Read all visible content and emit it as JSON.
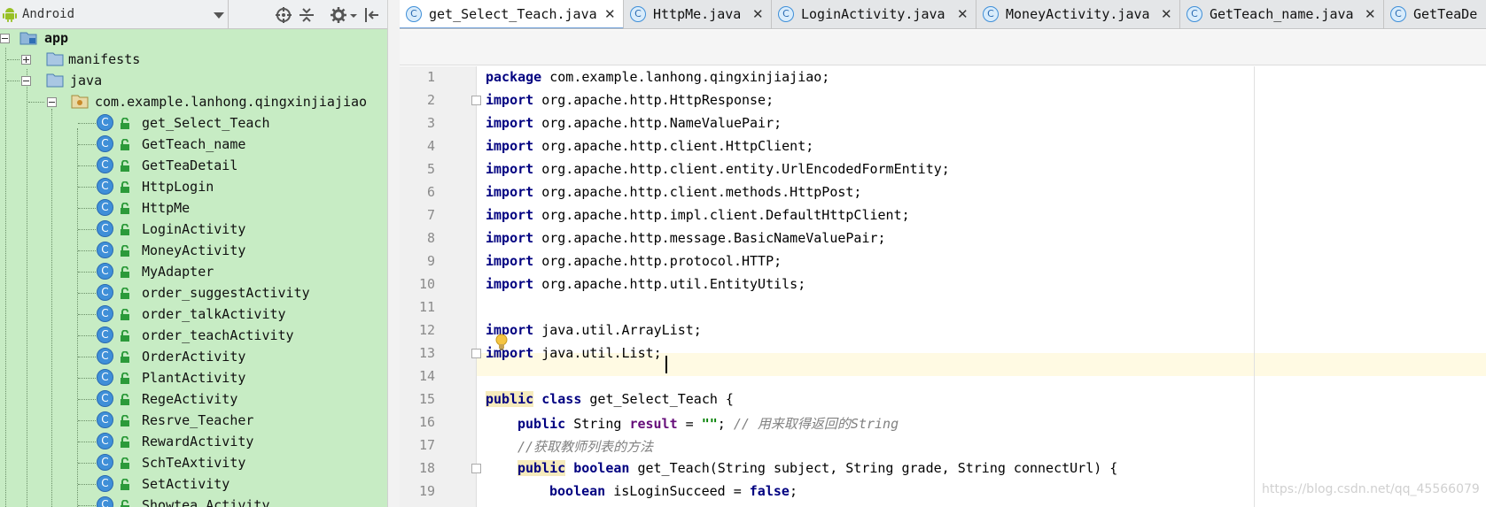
{
  "project_panel": {
    "view_mode": "Android",
    "tree": {
      "root": "app",
      "manifests": "manifests",
      "java": "java",
      "package": "com.example.lanhong.qingxinjiajiao",
      "classes": [
        "get_Select_Teach",
        "GetTeach_name",
        "GetTeaDetail",
        "HttpLogin",
        "HttpMe",
        "LoginActivity",
        "MoneyActivity",
        "MyAdapter",
        "order_suggestActivity",
        "order_talkActivity",
        "order_teachActivity",
        "OrderActivity",
        "PlantActivity",
        "RegeActivity",
        "Resrve_Teacher",
        "RewardActivity",
        "SchTeAxtivity",
        "SetActivity",
        "Showtea Activity"
      ]
    },
    "icons": [
      "android-icon",
      "target-icon",
      "collapse-all-icon",
      "gear-icon",
      "hide-panel-icon"
    ]
  },
  "tabs": [
    {
      "label": "get_Select_Teach.java",
      "active": true
    },
    {
      "label": "HttpMe.java",
      "active": false
    },
    {
      "label": "LoginActivity.java",
      "active": false
    },
    {
      "label": "MoneyActivity.java",
      "active": false
    },
    {
      "label": "GetTeach_name.java",
      "active": false
    },
    {
      "label": "GetTeaDe",
      "active": false
    }
  ],
  "editor": {
    "line_numbers": [
      "1",
      "2",
      "3",
      "4",
      "5",
      "6",
      "7",
      "8",
      "9",
      "10",
      "11",
      "12",
      "13",
      "14",
      "15",
      "16",
      "17",
      "18",
      "19"
    ],
    "caret_line": 13,
    "lines": {
      "l1_kw": "package",
      "l1_rest": " com.example.lanhong.qingxinjiajiao;",
      "l2_kw": "import",
      "l2_rest": " org.apache.http.HttpResponse;",
      "l3_kw": "import",
      "l3_rest": " org.apache.http.NameValuePair;",
      "l4_kw": "import",
      "l4_rest": " org.apache.http.client.HttpClient;",
      "l5_kw": "import",
      "l5_rest": " org.apache.http.client.entity.UrlEncodedFormEntity;",
      "l6_kw": "import",
      "l6_rest": " org.apache.http.client.methods.HttpPost;",
      "l7_kw": "import",
      "l7_rest": " org.apache.http.impl.client.DefaultHttpClient;",
      "l8_kw": "import",
      "l8_rest": " org.apache.http.message.BasicNameValuePair;",
      "l9_kw": "import",
      "l9_rest": " org.apache.http.protocol.HTTP;",
      "l10_kw": "import",
      "l10_rest": " org.apache.http.util.EntityUtils;",
      "l12_kw": "import",
      "l12_rest": " java.util.ArrayList;",
      "l13_kw": "import",
      "l13_rest": " java.util.List;",
      "l15_kw1": "public",
      "l15_kw2": " class",
      "l15_rest": " get_Select_Teach {",
      "l16_kw": "public",
      "l16_type": " String ",
      "l16_field": "result",
      "l16_eq": " = ",
      "l16_str": "\"\"",
      "l16_semi": "; ",
      "l16_cmt": "// 用来取得返回的String",
      "l17_cmt": "//获取教师列表的方法",
      "l18_kw1": "public",
      "l18_kw2": " boolean",
      "l18_rest": " get_Teach(String subject, String grade, String connectUrl) {",
      "l19_kw": "boolean",
      "l19_rest": " isLoginSucceed = ",
      "l19_kw2": "false",
      "l19_semi": ";"
    }
  },
  "watermark": "https://blog.csdn.net/qq_45566079"
}
